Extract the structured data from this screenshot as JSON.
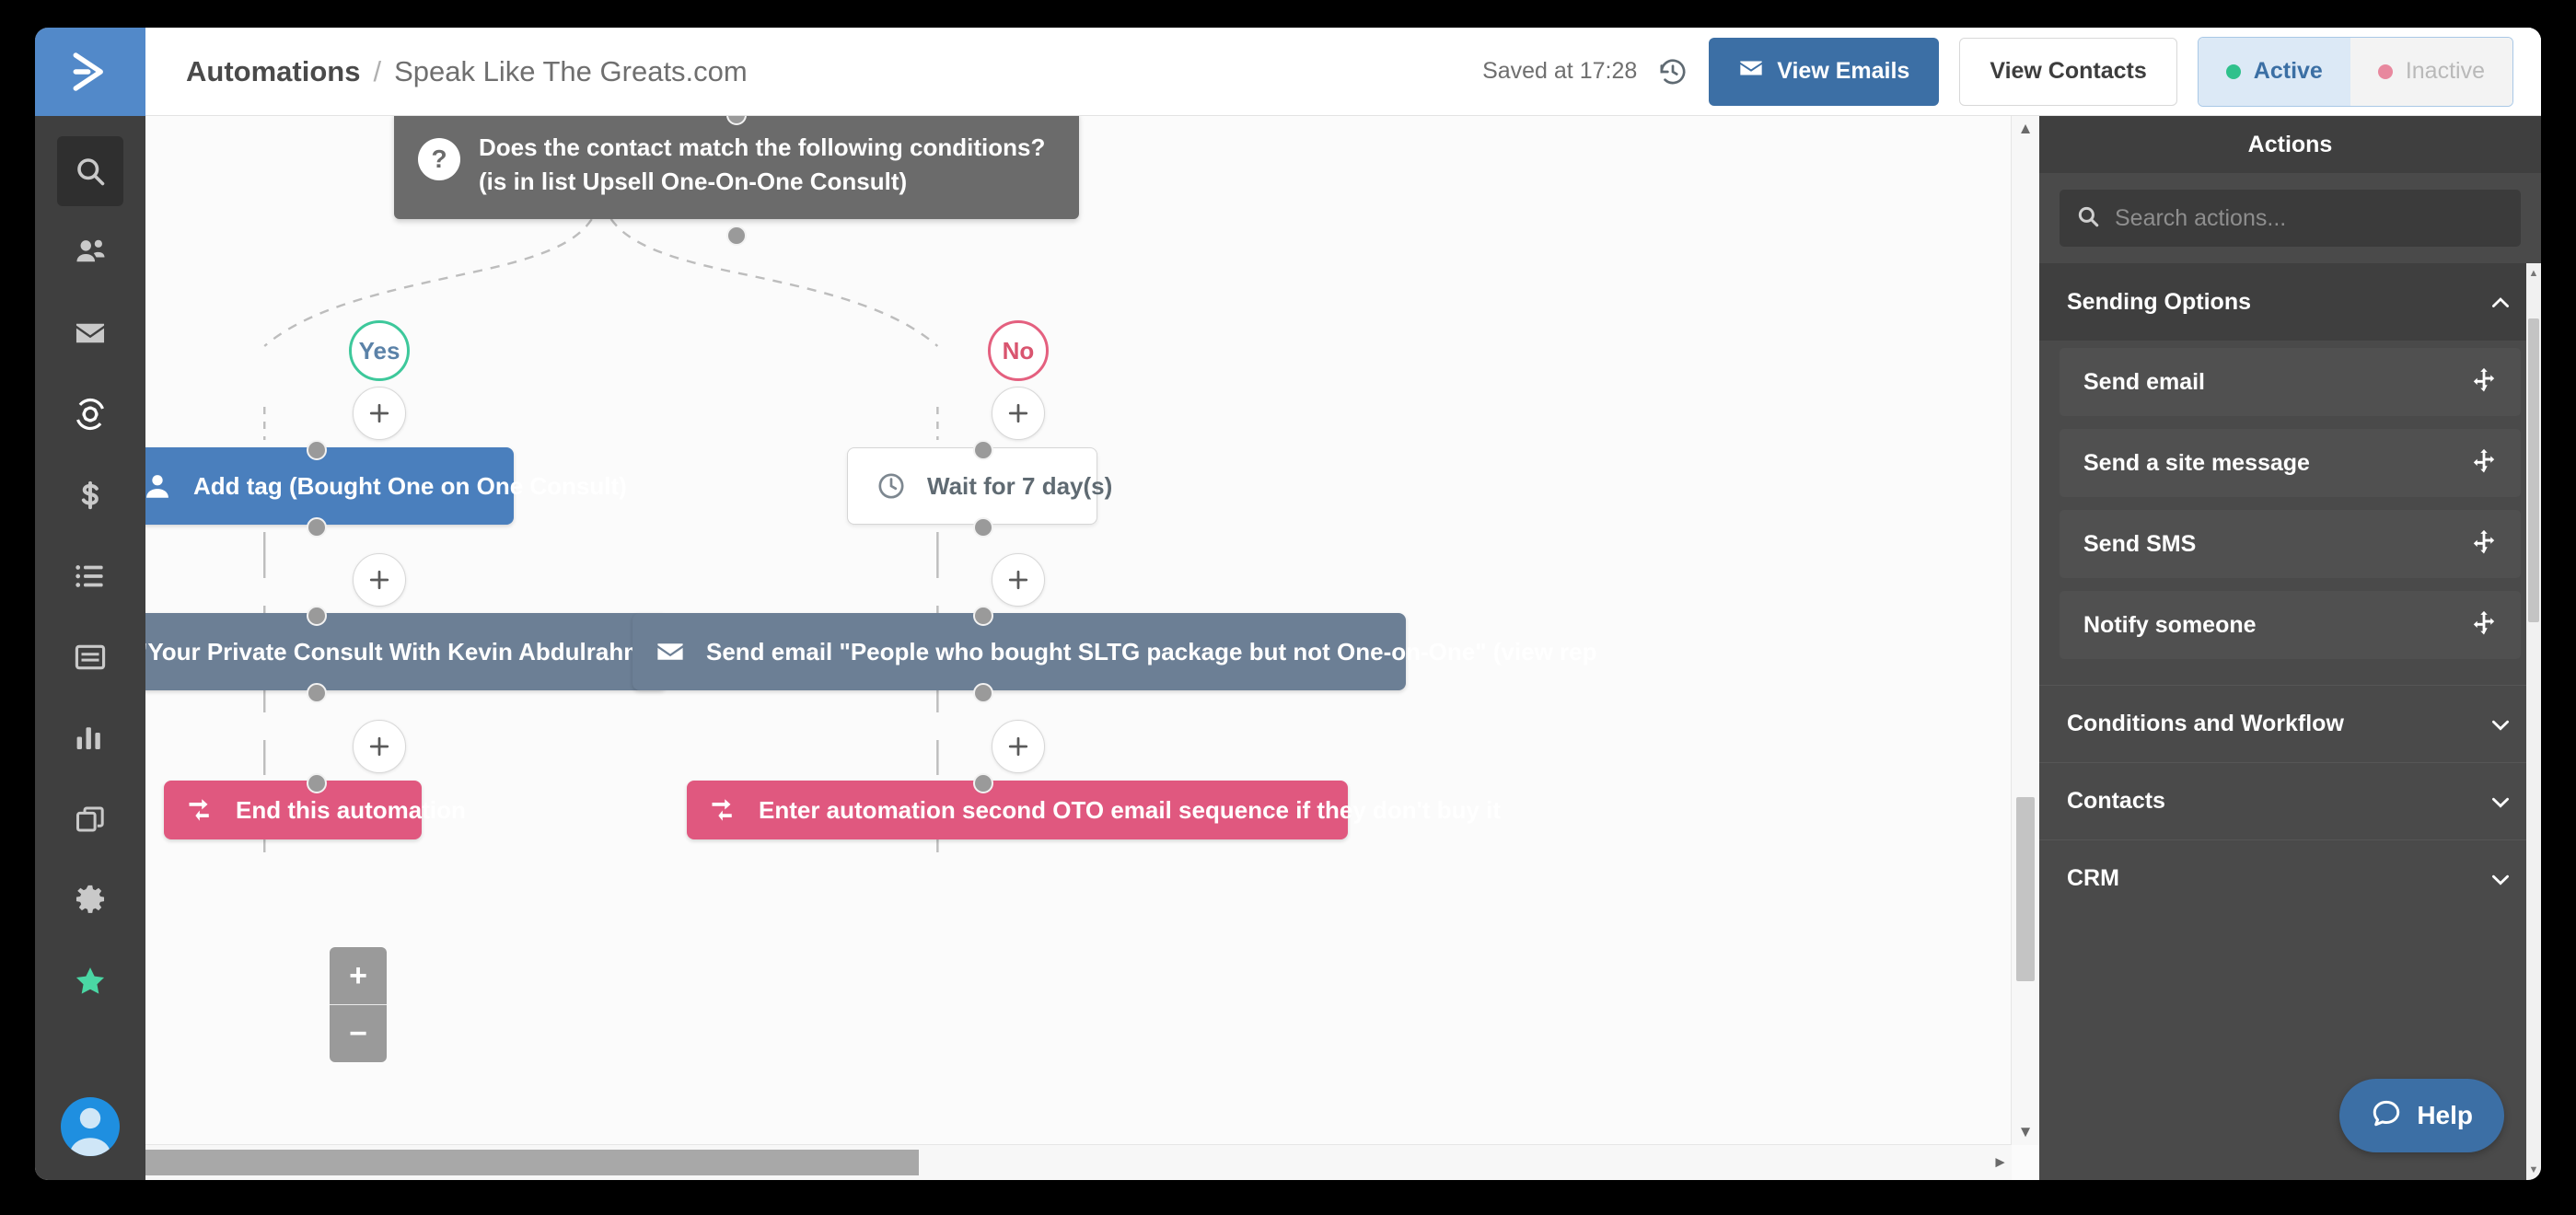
{
  "window": {
    "title": "Automations / Speak Like The Greats.com"
  },
  "sidebar": {
    "logo_icon": "activecampaign-logo-icon",
    "items": [
      {
        "icon": "search-icon",
        "name": "search",
        "state": "active"
      },
      {
        "icon": "contacts-icon",
        "name": "contacts",
        "state": "normal"
      },
      {
        "icon": "envelope-icon",
        "name": "campaigns",
        "state": "normal"
      },
      {
        "icon": "automations-icon",
        "name": "automations",
        "state": "selected"
      },
      {
        "icon": "dollar-icon",
        "name": "deals",
        "state": "normal"
      },
      {
        "icon": "list-icon",
        "name": "lists",
        "state": "normal"
      },
      {
        "icon": "forms-icon",
        "name": "forms",
        "state": "normal"
      },
      {
        "icon": "bar-chart-icon",
        "name": "reports",
        "state": "normal"
      },
      {
        "icon": "copy-icon",
        "name": "templates",
        "state": "normal"
      },
      {
        "icon": "gear-icon",
        "name": "settings",
        "state": "normal"
      },
      {
        "icon": "star-icon",
        "name": "favorites",
        "state": "star"
      }
    ],
    "avatar_icon": "user-avatar-icon"
  },
  "header": {
    "breadcrumb_root": "Automations",
    "breadcrumb_sep": "/",
    "breadcrumb_leaf": "Speak Like The Greats.com",
    "saved_status": "Saved at 17:28",
    "history_icon": "history-clock-icon",
    "view_emails_label": "View Emails",
    "view_emails_icon": "envelope-icon",
    "view_contacts_label": "View Contacts",
    "status_active_label": "Active",
    "status_inactive_label": "Inactive",
    "active_color": "#2fc18c",
    "inactive_color": "#e8889e",
    "primary_color": "#3c6fa5"
  },
  "canvas": {
    "condition_node": {
      "icon": "question-mark-icon",
      "label": "Does the contact match the following conditions? (is in list Upsell One-On-One Consult)"
    },
    "branch_yes": {
      "label": "Yes",
      "color": "#3dc89b"
    },
    "branch_no": {
      "label": "No",
      "color": "#e4607f"
    },
    "add_icon": "plus-icon",
    "left_branch": [
      {
        "type": "tag",
        "icon": "user-tag-icon",
        "label": "Add tag (Bought One on One Consult)"
      },
      {
        "type": "email",
        "icon": "envelope-icon",
        "label": "\"Your Private Consult With Kevin Abdulrahman\" (view reports)"
      },
      {
        "type": "end",
        "icon": "exchange-arrows-icon",
        "label": "End this automation"
      }
    ],
    "right_branch": [
      {
        "type": "wait",
        "icon": "clock-icon",
        "label": "Wait for 7 day(s)"
      },
      {
        "type": "email",
        "icon": "envelope-icon",
        "label": "Send email \"People who bought SLTG package but not One-on-One\" (view rep"
      },
      {
        "type": "end",
        "icon": "exchange-arrows-icon",
        "label": "Enter automation second OTO email sequence if they don't buy it"
      }
    ],
    "zoom_in_label": "+",
    "zoom_out_label": "−"
  },
  "panel": {
    "title": "Actions",
    "search_placeholder": "Search actions...",
    "search_value": "",
    "search_icon": "search-icon",
    "sections": [
      {
        "title": "Sending Options",
        "expanded": true,
        "chevron": "chevron-up-icon",
        "items": [
          {
            "label": "Send email",
            "handle": "move-handle-icon"
          },
          {
            "label": "Send a site message",
            "handle": "move-handle-icon"
          },
          {
            "label": "Send SMS",
            "handle": "move-handle-icon"
          },
          {
            "label": "Notify someone",
            "handle": "move-handle-icon"
          }
        ]
      },
      {
        "title": "Conditions and Workflow",
        "expanded": false,
        "chevron": "chevron-down-icon",
        "items": []
      },
      {
        "title": "Contacts",
        "expanded": false,
        "chevron": "chevron-down-icon",
        "items": []
      },
      {
        "title": "CRM",
        "expanded": false,
        "chevron": "chevron-down-icon",
        "items": []
      }
    ]
  },
  "help": {
    "label": "Help",
    "icon": "chat-bubble-icon"
  }
}
